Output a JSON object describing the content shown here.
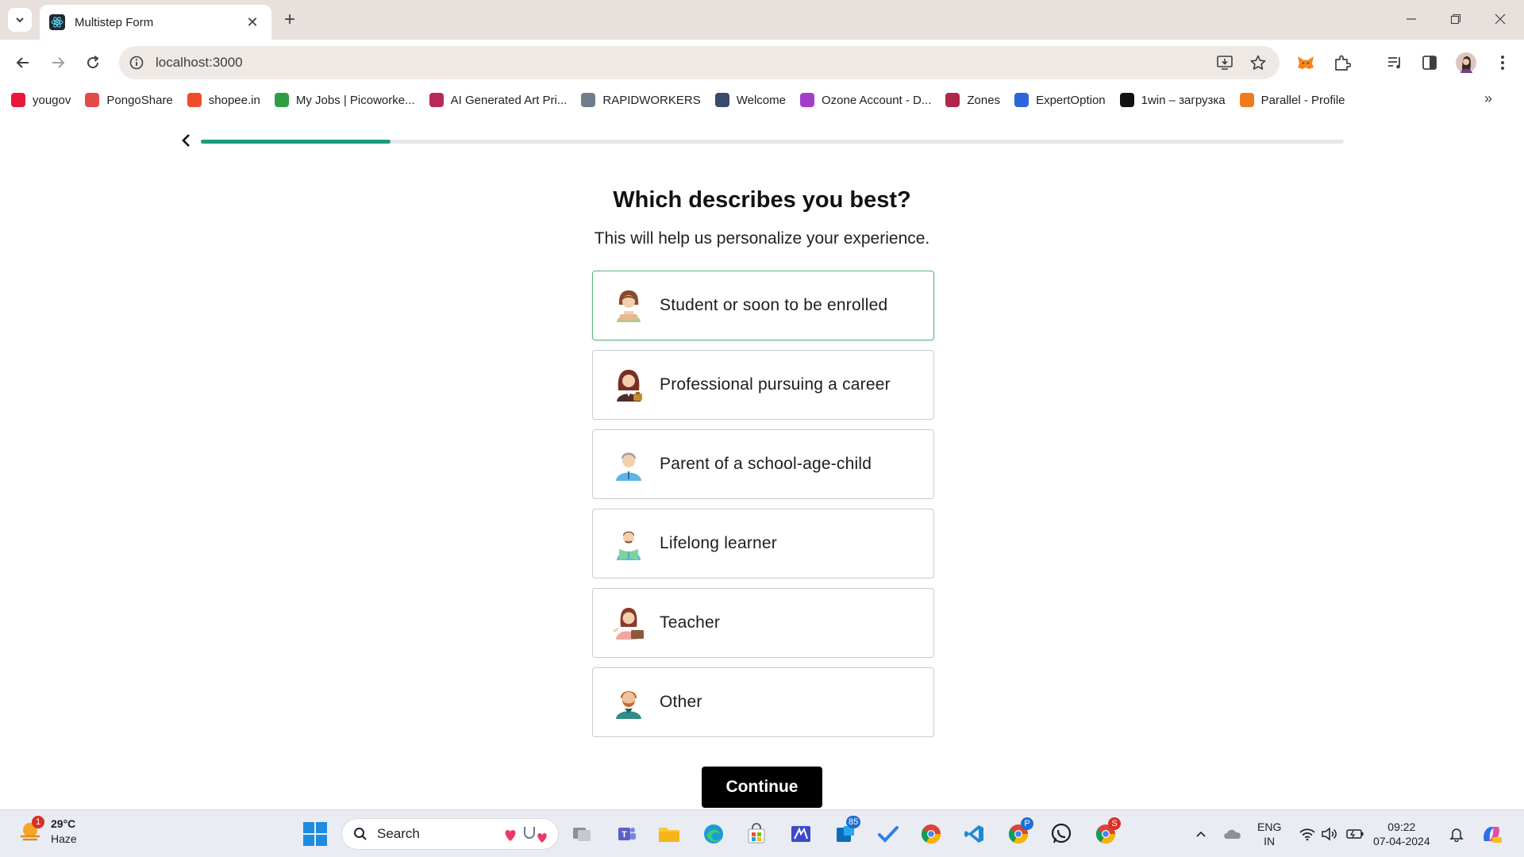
{
  "browser": {
    "tab_title": "Multistep Form",
    "url": "localhost:3000",
    "bookmarks": [
      {
        "label": "yougov",
        "icon": "yougov-icon",
        "color": "#e8183a"
      },
      {
        "label": "PongoShare",
        "icon": "pongoshare-icon",
        "color": "#e34a4a"
      },
      {
        "label": "shopee.in",
        "icon": "shopee-icon",
        "color": "#ee4d2d"
      },
      {
        "label": "My Jobs | Picoworke...",
        "icon": "picoworkers-icon",
        "color": "#2e9e44"
      },
      {
        "label": "AI Generated Art Pri...",
        "icon": "nc-icon",
        "color": "#b52a5a"
      },
      {
        "label": "RAPIDWORKERS",
        "icon": "rapidworkers-icon",
        "color": "#6f7d8c"
      },
      {
        "label": "Welcome",
        "icon": "welcome-icon",
        "color": "#3a4a6a"
      },
      {
        "label": "Ozone Account - D...",
        "icon": "ozone-icon",
        "color": "#a23ec9"
      },
      {
        "label": "Zones",
        "icon": "zones-icon",
        "color": "#b0274c"
      },
      {
        "label": "ExpertOption",
        "icon": "expertoption-icon",
        "color": "#2a66d9"
      },
      {
        "label": "1win – загрузка",
        "icon": "1win-icon",
        "color": "#111111"
      },
      {
        "label": "Parallel - Profile",
        "icon": "parallel-icon",
        "color": "#f07b1d"
      }
    ]
  },
  "form": {
    "progress": 0.166,
    "title": "Which describes you best?",
    "subtitle": "This will help us personalize your experience.",
    "options": [
      {
        "label": "Student or soon to be enrolled",
        "selected": true
      },
      {
        "label": "Professional pursuing a career",
        "selected": false
      },
      {
        "label": "Parent of a school-age-child",
        "selected": false
      },
      {
        "label": "Lifelong learner",
        "selected": false
      },
      {
        "label": "Teacher",
        "selected": false
      },
      {
        "label": "Other",
        "selected": false
      }
    ],
    "continue_label": "Continue",
    "accent_color": "#1a9a7d",
    "selected_border_color": "#55b77b"
  },
  "taskbar": {
    "weather_temp": "29°C",
    "weather_desc": "Haze",
    "weather_badge": "1",
    "search_label": "Search",
    "todo_badge": "85",
    "chrome_p_badge": "P",
    "chrome_s_badge": "S",
    "lang_top": "ENG",
    "lang_bottom": "IN",
    "time": "09:22",
    "date": "07-04-2024"
  }
}
